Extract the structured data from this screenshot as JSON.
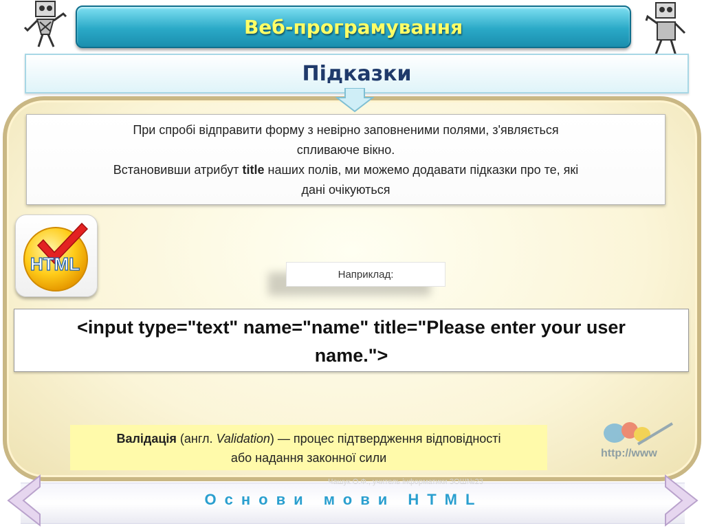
{
  "header": {
    "title": "Веб-програмування"
  },
  "subtitle": {
    "title": "Підказки"
  },
  "description": {
    "line1": "При спробі відправити форму з невірно заповненими полями, з'являється",
    "line2": "спливаюче вікно.",
    "line3_before": "Встановивши атрибут ",
    "line3_bold": "title",
    "line3_after": " наших полів, ми можемо додавати підказки про те, які",
    "line4": "дані очікуються"
  },
  "logo": {
    "text": "HTML",
    "icon": "html-checkmark-icon"
  },
  "example": {
    "label": "Наприклад:"
  },
  "code": {
    "line1": "<input type=\"text\" name=\"name\" title=\"Please enter your user",
    "line2": "name.\">"
  },
  "validation": {
    "term": "Валідація",
    "before": " (англ. ",
    "term_en": "Validation",
    "after": ") — процес підтвердження відповідності",
    "line2": "або надання законної сили"
  },
  "decor": {
    "http_text": "http://www"
  },
  "footer": {
    "title": "Основи мови HTML",
    "watermark": "Чашук О.Ф., учитель інформатики ЗОШ№23"
  },
  "colors": {
    "header_text": "#ffff66",
    "footer_text": "#2a9fcf",
    "validation_bg": "#fffaaa"
  }
}
